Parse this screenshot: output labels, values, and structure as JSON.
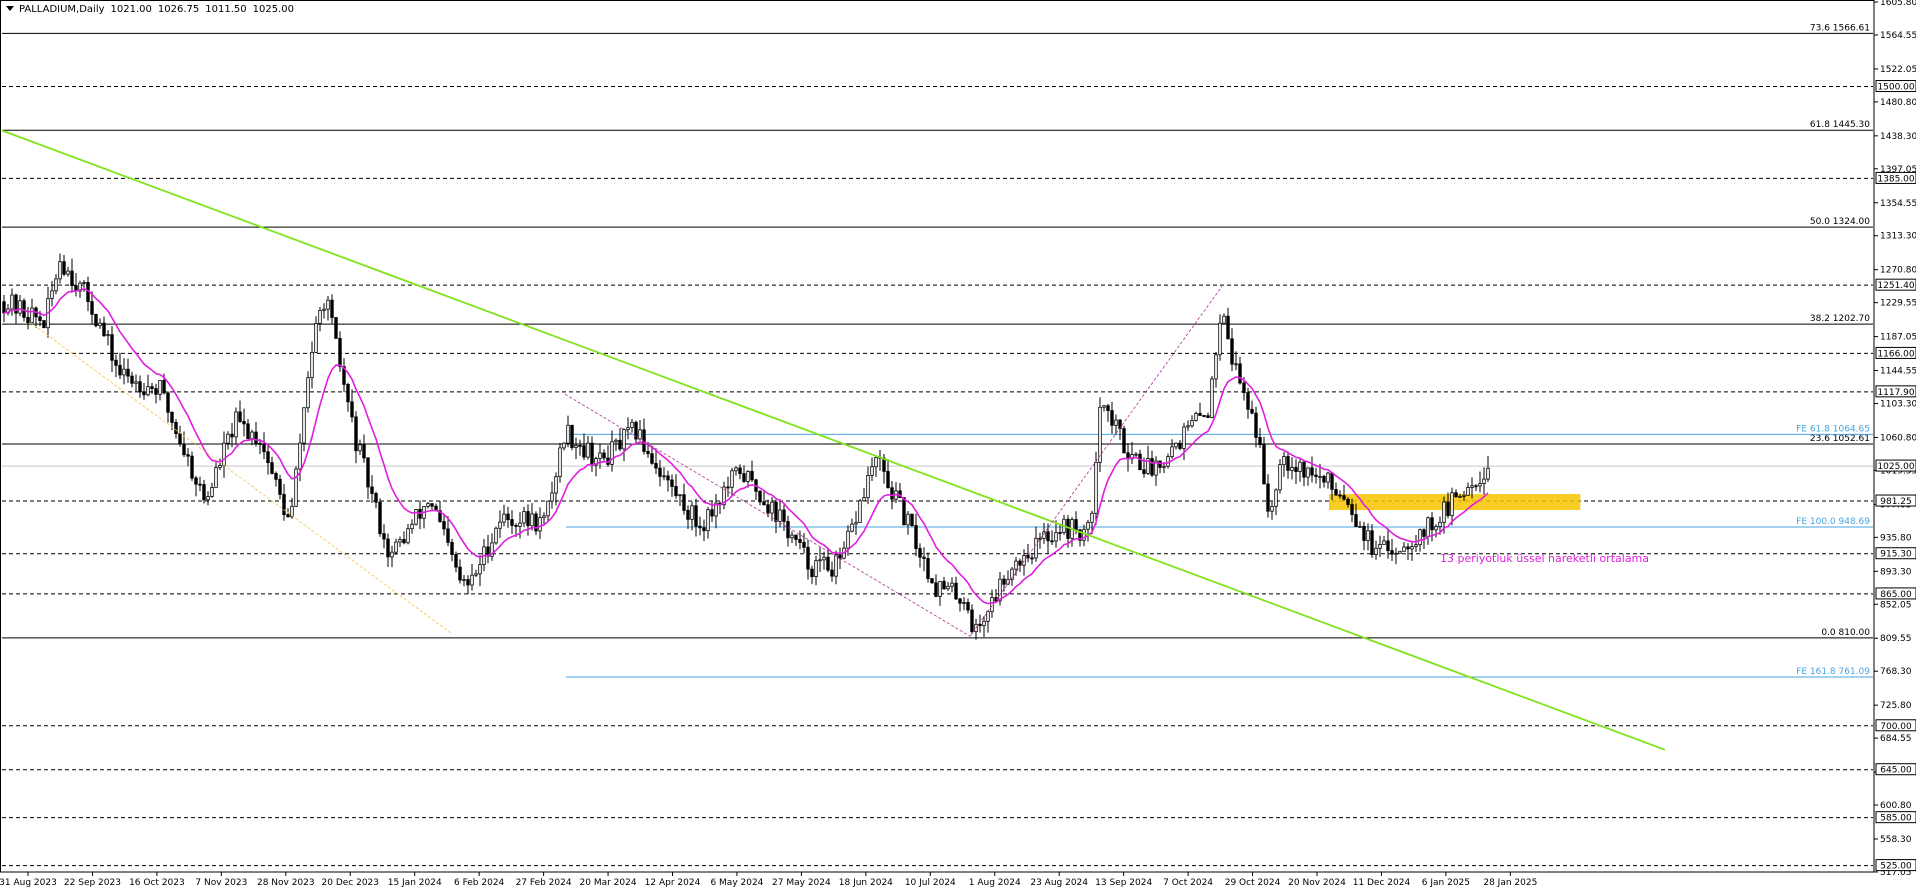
{
  "header": {
    "symbol": "PALLADIUM,Daily",
    "open": "1021.00",
    "high": "1026.75",
    "low": "1011.50",
    "close": "1025.00"
  },
  "annotation": {
    "ema_label": "13 periyotluk üssel hareketli ortalama"
  },
  "colors": {
    "background": "#ffffff",
    "candle": "#000000",
    "ema": "#e01ee0",
    "trendline": "#7fe31c",
    "fe_lines": "#4aa3df",
    "support_zone": "#f7c600",
    "dashed_fib": "#b1309a",
    "orange_dashed": "#f5c242"
  },
  "chart_data": {
    "type": "candlestick",
    "ylim": [
      517.0,
      1605.8
    ],
    "x_labels": [
      "31 Aug 2023",
      "22 Sep 2023",
      "16 Oct 2023",
      "7 Nov 2023",
      "28 Nov 2023",
      "20 Dec 2023",
      "15 Jan 2024",
      "6 Feb 2024",
      "27 Feb 2024",
      "20 Mar 2024",
      "12 Apr 2024",
      "6 May 2024",
      "27 May 2024",
      "18 Jun 2024",
      "10 Jul 2024",
      "1 Aug 2024",
      "23 Aug 2024",
      "13 Sep 2024",
      "7 Oct 2024",
      "29 Oct 2024",
      "20 Nov 2024",
      "11 Dec 2024",
      "6 Jan 2025",
      "28 Jan 2025"
    ],
    "y_ticks": [
      "1605.80",
      "1564.55",
      "1522.05",
      "1480.80",
      "1438.30",
      "1397.05",
      "1354.55",
      "1313.30",
      "1270.80",
      "1229.55",
      "1187.05",
      "1144.55",
      "1103.30",
      "1060.80",
      "1019.55",
      "977.05",
      "935.80",
      "893.30",
      "852.05",
      "809.55",
      "768.30",
      "725.80",
      "684.55",
      "642.05",
      "600.80",
      "558.30",
      "517.05"
    ],
    "price_levels": [
      {
        "value": 1500.0,
        "label": "1500.00",
        "style": "dashed"
      },
      {
        "value": 1385.0,
        "label": "1385.00",
        "style": "dashed"
      },
      {
        "value": 1251.4,
        "label": "1251.40",
        "style": "dashed"
      },
      {
        "value": 1166.0,
        "label": "1166.00",
        "style": "dashed"
      },
      {
        "value": 1117.9,
        "label": "1117.90",
        "style": "dashed"
      },
      {
        "value": 981.25,
        "label": "981.25",
        "style": "dashed"
      },
      {
        "value": 915.3,
        "label": "915.30",
        "style": "dashed"
      },
      {
        "value": 865.0,
        "label": "865.00",
        "style": "dashed"
      },
      {
        "value": 700.0,
        "label": "700.00",
        "style": "dashed"
      },
      {
        "value": 645.0,
        "label": "645.00",
        "style": "dashed"
      },
      {
        "value": 585.0,
        "label": "585.00",
        "style": "dashed"
      },
      {
        "value": 525.0,
        "label": "525.00",
        "style": "dashed"
      }
    ],
    "current_price": {
      "value": 1025.0,
      "label": "1025.00"
    },
    "fib_levels": [
      {
        "value": 1566.61,
        "label": "73.6 1566.61"
      },
      {
        "value": 1445.3,
        "label": "61.8 1445.30"
      },
      {
        "value": 1324.0,
        "label": "50.0 1324.00"
      },
      {
        "value": 1202.7,
        "label": "38.2 1202.70"
      },
      {
        "value": 1052.61,
        "label": "23.6 1052.61"
      },
      {
        "value": 810.0,
        "label": "0.0 810.00"
      }
    ],
    "fe_levels": [
      {
        "value": 1064.65,
        "label": "FE 61.8 1064.65"
      },
      {
        "value": 948.69,
        "label": "FE 100.0 948.69"
      },
      {
        "value": 761.09,
        "label": "FE 161.8 761.09"
      }
    ],
    "trendline": {
      "from": {
        "date": "31 Aug 2023",
        "price": 1445.0
      },
      "to": {
        "date": "28 Jan 2025",
        "price": 742.0
      }
    },
    "support_zone": {
      "from_date": "20 Nov 2024",
      "to_date": "28 Jan 2025",
      "low": 970.0,
      "high": 990.0
    },
    "ema_period": 13
  }
}
